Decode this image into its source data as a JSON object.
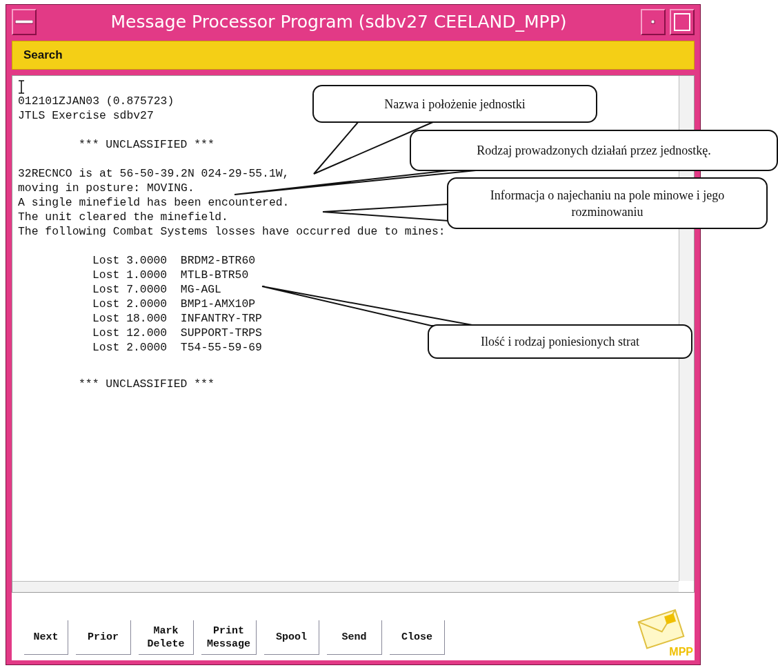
{
  "window": {
    "title": "Message Processor Program (sdbv27 CEELAND_MPP)"
  },
  "menu": [
    {
      "label": "Search"
    }
  ],
  "message": {
    "header": [
      "012101ZJAN03 (0.875723)",
      "JTLS Exercise sdbv27"
    ],
    "classification": "*** UNCLASSIFIED ***",
    "body": [
      "32RECNCO is at 56-50-39.2N 024-29-55.1W,",
      "moving in posture: MOVING.",
      "A single minefield has been encountered.",
      "The unit cleared the minefield.",
      "The following Combat Systems losses have occurred due to mines:"
    ],
    "losses": [
      "Lost 3.0000  BRDM2-BTR60",
      "Lost 1.0000  MTLB-BTR50",
      "Lost 7.0000  MG-AGL",
      "Lost 2.0000  BMP1-AMX10P",
      "Lost 18.000  INFANTRY-TRP",
      "Lost 12.000  SUPPORT-TRPS",
      "Lost 2.0000  T54-55-59-69"
    ],
    "classification_footer": "*** UNCLASSIFIED ***"
  },
  "buttons": [
    {
      "label": "Next"
    },
    {
      "label": "Prior"
    },
    {
      "label": "Mark Delete"
    },
    {
      "label": "Print Message"
    },
    {
      "label": "Spool"
    },
    {
      "label": "Send"
    },
    {
      "label": "Close"
    }
  ],
  "logo": {
    "text": "MPP"
  },
  "callouts": [
    {
      "text": "Nazwa i położenie jednostki"
    },
    {
      "text": "Rodzaj prowadzonych działań przez jednostkę."
    },
    {
      "text": "Informacja o najechaniu na pole minowe i jego rozminowaniu"
    },
    {
      "text": "Ilość i rodzaj poniesionych strat"
    }
  ]
}
